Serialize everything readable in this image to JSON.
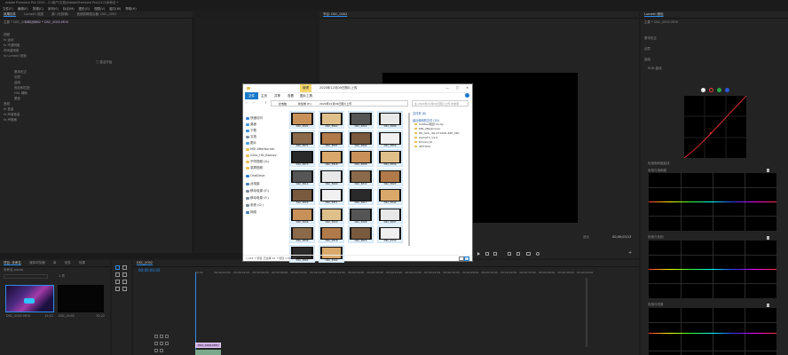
{
  "app": {
    "title": "Adobe Premiere Pro 2020 - C:\\用户\\文档\\Adobe\\Premiere Pro\\14.0\\未命名 *"
  },
  "menu": [
    "文件(F)",
    "编辑(E)",
    "剪辑(C)",
    "序列(S)",
    "标记(M)",
    "图形(G)",
    "视图(V)",
    "窗口(W)",
    "帮助(H)"
  ],
  "effect_controls": {
    "tabs": [
      "效果控件",
      "Lumetri 范围",
      "源: (无剪辑)",
      "音频剪辑混合器: DSC_0002"
    ],
    "clip": "主要 * DSC_0002.MOV",
    "seq": "DSC_0002 * DSC_0002.MOV",
    "rows": [
      "视频",
      "fx 运动",
      "fx 不透明度",
      "时间重映射",
      "fx Lumetri 颜色",
      "",
      "",
      "基本校正",
      "创意",
      "曲线",
      "色轮和匹配",
      "HSL 辅助",
      "晕影",
      "音频",
      "fx 音量",
      "fx 声道音量",
      "fx 声像器"
    ],
    "center_text": "□ 激活开始"
  },
  "program": {
    "tabs": [
      "节目: DSC_0002"
    ],
    "fit": "适合",
    "timecode": "00;00;03;13"
  },
  "lumetri": {
    "tab": "Lumetri 颜色",
    "clip": "主要 * DSC_0002.MOV",
    "sections": [
      "基本校正",
      "创意",
      "曲线",
      "RGB 曲线",
      "色相饱和度曲线",
      "色相与饱和度",
      "色相与色相",
      "色相与亮度"
    ]
  },
  "project": {
    "tabs": [
      "项目: 未命名",
      "媒体浏览器",
      "库",
      "信息",
      "效果"
    ],
    "file": "未命名.prproj",
    "count": "2 项",
    "items": [
      {
        "name": "DSC_0002.MOV",
        "dur": "15;22"
      },
      {
        "name": "DSC_0002",
        "dur": "15;22"
      }
    ]
  },
  "timeline": {
    "tab": "DSC_0002",
    "timecode": "00;00;00;00",
    "ticks": [
      "00;00",
      "00;00;02;00",
      "00;00;04;00",
      "00;00;06;00",
      "00;00;08;00",
      "00;00;10;00",
      "00;00;12;00",
      "00;00;14;00",
      "00;00;16;00",
      "00;00;18;00",
      "00;00;20;00",
      "00;00;22;00",
      "00;00;24;00",
      "00;00;26;00",
      "00;00;28;00",
      "00;00;30;00",
      "00;00;32;00",
      "00;00;34;00",
      "00;00;36;00",
      "00;00;38;00",
      "00;00;40;00"
    ],
    "clip": "DSC_0002.MOV"
  },
  "explorer": {
    "title": "2020年12月09日照片上传",
    "ribbon": [
      "文件",
      "主页",
      "共享",
      "查看"
    ],
    "manage": "管理",
    "picture_tools": "图片工具",
    "path": [
      "此电脑",
      "新加卷 (E:)",
      "2020年12月09日照片上传"
    ],
    "search": "在 2020年12月09日照片上传 中搜索",
    "nav": [
      {
        "label": "快速访问",
        "icon": "star-icon",
        "color": "#3b83d8"
      },
      {
        "label": "桌面",
        "icon": "desktop-icon",
        "color": "#4b9ce8"
      },
      {
        "label": "下载",
        "icon": "download-icon",
        "color": "#3d8ee0"
      },
      {
        "label": "文档",
        "icon": "documents-icon",
        "color": "#7f8ea0"
      },
      {
        "label": "图片",
        "icon": "pictures-icon",
        "color": "#4aa0e6"
      },
      {
        "label": "MSI Afterburner",
        "icon": "folder-icon",
        "color": "#e8c15a"
      },
      {
        "label": "v2ex_HD_Boxcsv",
        "icon": "folder-icon",
        "color": "#e8c15a"
      },
      {
        "label": "不同视频 (A:)",
        "icon": "folder-icon",
        "color": "#e8c15a"
      },
      {
        "label": "录屏视频",
        "icon": "folder-icon",
        "color": "#e8c15a"
      },
      {
        "label": "OneDrive",
        "icon": "cloud-icon",
        "color": "#2a7bd4"
      },
      {
        "label": "此电脑",
        "icon": "computer-icon",
        "color": "#4a7fb8"
      },
      {
        "label": "移动电源 (E:)",
        "icon": "drive-icon",
        "color": "#7a8a99"
      },
      {
        "label": "移动电源 (F:)",
        "icon": "drive-icon",
        "color": "#7a8a99"
      },
      {
        "label": "系统 (G:)",
        "icon": "drive-icon",
        "color": "#7a8a99"
      },
      {
        "label": "网络",
        "icon": "network-icon",
        "color": "#4a7fb8"
      }
    ],
    "files": [
      "DSC_5621",
      "DSC_5801",
      "DSC_5822",
      "DSC_5889",
      "DSC_5871",
      "DSC_5807",
      "DSC_5804",
      "DSC_5850",
      "DSC_5873",
      "DSC_5818",
      "DSC_5808",
      "DSC_5839",
      "DSC_5819",
      "DSC_5890",
      "DSC_5872",
      "DSC_5825",
      "DSC_5829",
      "DSC_5811",
      "DSC_5817",
      "DSC_5840",
      "DSC_5826",
      "DSC_5820",
      "DSC_5898",
      "DSC_5897",
      "DSC_5838",
      "DSC_5878",
      "DSC_5823",
      "DSC_5133",
      "DSC_5862",
      "DSC_5902"
    ],
    "status": "1,024 个项目  已选择 24 个项目  1.56 GB",
    "quick_header": "文件夹 (6)",
    "recent_header": "最近使用的文件 (20)",
    "right_files": [
      "Untitled项目.7z.zip",
      "MSI_Afterburner",
      "HD_Skin_dip.4712CR-49H_Skit",
      "GameTV_V1.0",
      "Drivers_KI",
      "GIFTOCS"
    ]
  },
  "colors": {
    "accent": "#2d8ceb",
    "clip": "#c9a5e0",
    "sel": "#cce8ff"
  }
}
